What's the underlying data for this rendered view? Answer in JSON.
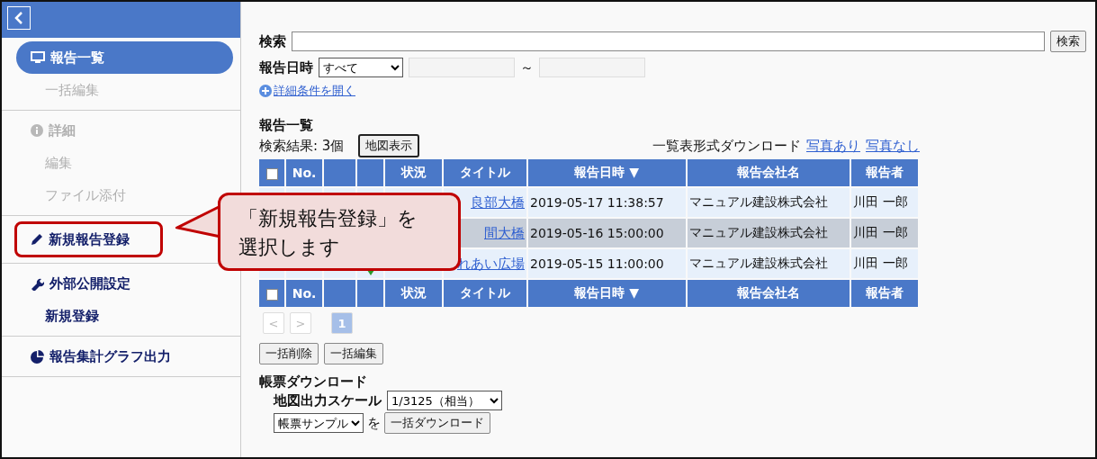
{
  "sidebar": {
    "groups": [
      {
        "items": [
          {
            "label": "報告一覧",
            "kind": "main",
            "selected": true,
            "disabled": false
          },
          {
            "label": "一括編集",
            "kind": "sub",
            "selected": false,
            "disabled": true
          }
        ]
      },
      {
        "items": [
          {
            "label": "詳細",
            "kind": "main",
            "selected": false,
            "disabled": true
          },
          {
            "label": "編集",
            "kind": "sub",
            "selected": false,
            "disabled": true
          },
          {
            "label": "ファイル添付",
            "kind": "sub",
            "selected": false,
            "disabled": true
          }
        ]
      },
      {
        "items": [
          {
            "label": "新規報告登録",
            "kind": "main",
            "selected": false,
            "disabled": false,
            "highlighted": true
          }
        ]
      },
      {
        "items": [
          {
            "label": "外部公開設定",
            "kind": "main",
            "selected": false,
            "disabled": false
          },
          {
            "label": "新規登録",
            "kind": "sub",
            "selected": false,
            "disabled": false
          }
        ]
      },
      {
        "items": [
          {
            "label": "報告集計グラフ出力",
            "kind": "main",
            "selected": false,
            "disabled": false
          }
        ]
      }
    ]
  },
  "search": {
    "label": "検索",
    "button": "検索",
    "date_label": "報告日時",
    "date_select": "すべて",
    "range_sep": "～",
    "date_from": {
      "disabled": true
    },
    "date_to": {
      "disabled": true
    },
    "detail_link": "詳細条件を開く"
  },
  "list": {
    "title": "報告一覧",
    "result": "検索結果: 3個",
    "map_button": "地図表示",
    "download_label": "一覧表形式ダウンロード",
    "download_links": [
      "写真あり",
      "写真なし"
    ]
  },
  "table": {
    "header_checkbox": {
      "checked": false
    },
    "columns": [
      "",
      "No.",
      "",
      "",
      "状況",
      "タイトル",
      "報告日時 ▼",
      "報告会社名",
      "報告者"
    ],
    "footer_checkbox": {
      "checked": false
    },
    "footer_columns": [
      "",
      "No.",
      "",
      "",
      "状況",
      "タイトル",
      "報告日時 ▼",
      "報告会社名",
      "報告者"
    ],
    "rows": [
      {
        "title": "良部大橋",
        "date": "2019-05-17 11:38:57",
        "company": "マニュアル建設株式会社",
        "reporter": "川田 一郎",
        "selected": false,
        "flag": false
      },
      {
        "title": "間大橋",
        "date": "2019-05-16 15:00:00",
        "company": "マニュアル建設株式会社",
        "reporter": "川田 一郎",
        "selected": true,
        "flag": false
      },
      {
        "title": "れあい広場",
        "date": "2019-05-15 11:00:00",
        "company": "マニュアル建設株式会社",
        "reporter": "川田 一郎",
        "selected": false,
        "flag": true
      }
    ]
  },
  "pagination": {
    "prev": "<",
    "next": ">",
    "pages": [
      {
        "label": "1",
        "selected": true
      }
    ]
  },
  "bulk_buttons": [
    "一括削除",
    "一括編集"
  ],
  "report_download": {
    "title": "帳票ダウンロード",
    "scale_label": "地図出力スケール",
    "scale_select": "1/3125（相当）",
    "template_select": "帳票サンプル",
    "particle": "を",
    "button": "一括ダウンロード"
  },
  "callout": {
    "lines": [
      "「新規報告登録」を",
      "選択します"
    ]
  }
}
